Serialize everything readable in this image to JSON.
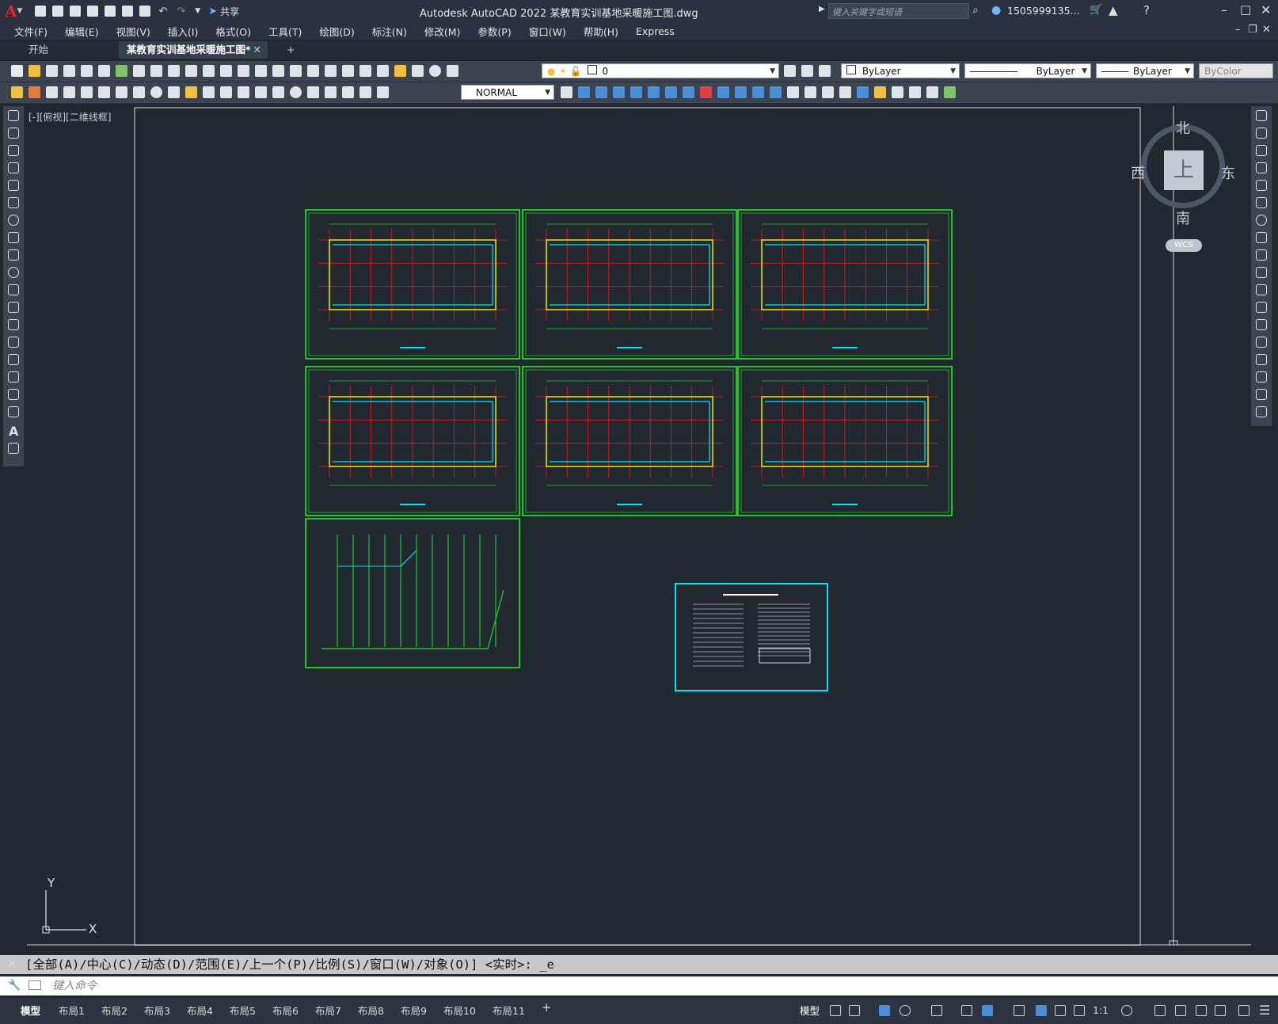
{
  "app": {
    "logo": "A",
    "title": "Autodesk AutoCAD 2022    某教育实训基地采暖施工图.dwg"
  },
  "quick_access": {
    "share_label": "共享"
  },
  "search": {
    "placeholder": "键入关键字或短语"
  },
  "user": {
    "name": "1505999135..."
  },
  "menu": [
    "文件(F)",
    "编辑(E)",
    "视图(V)",
    "插入(I)",
    "格式(O)",
    "工具(T)",
    "绘图(D)",
    "标注(N)",
    "修改(M)",
    "参数(P)",
    "窗口(W)",
    "帮助(H)",
    "Express"
  ],
  "tabs": {
    "start": "开始",
    "drawing": "某教育实训基地采暖施工图*",
    "add": "+",
    "close": "✕"
  },
  "properties": {
    "layer": "0",
    "color": "ByLayer",
    "linetype": "ByLayer",
    "lineweight": "ByLayer",
    "plotstyle": "ByColor",
    "dimstyle": "NORMAL"
  },
  "viewport": {
    "label": "[-][俯视][二维线框]"
  },
  "viewcube": {
    "top": "上",
    "north": "北",
    "south": "南",
    "east": "东",
    "west": "西",
    "wcs": "WCS"
  },
  "ucs": {
    "x": "X",
    "y": "Y"
  },
  "command": {
    "history": "[全部(A)/中心(C)/动态(D)/范围(E)/上一个(P)/比例(S)/窗口(W)/对象(O)] <实时>: _e",
    "placeholder": "键入命令"
  },
  "layouts": [
    "模型",
    "布局1",
    "布局2",
    "布局3",
    "布局4",
    "布局5",
    "布局6",
    "布局7",
    "布局8",
    "布局9",
    "布局10",
    "布局11"
  ],
  "status": {
    "model": "模型",
    "scale": "1:1"
  },
  "colors": {
    "frame_green": "#22c32a",
    "cyan": "#00e5f5",
    "red": "#e01f1f",
    "yellow": "#f2e600",
    "background": "#212830"
  }
}
